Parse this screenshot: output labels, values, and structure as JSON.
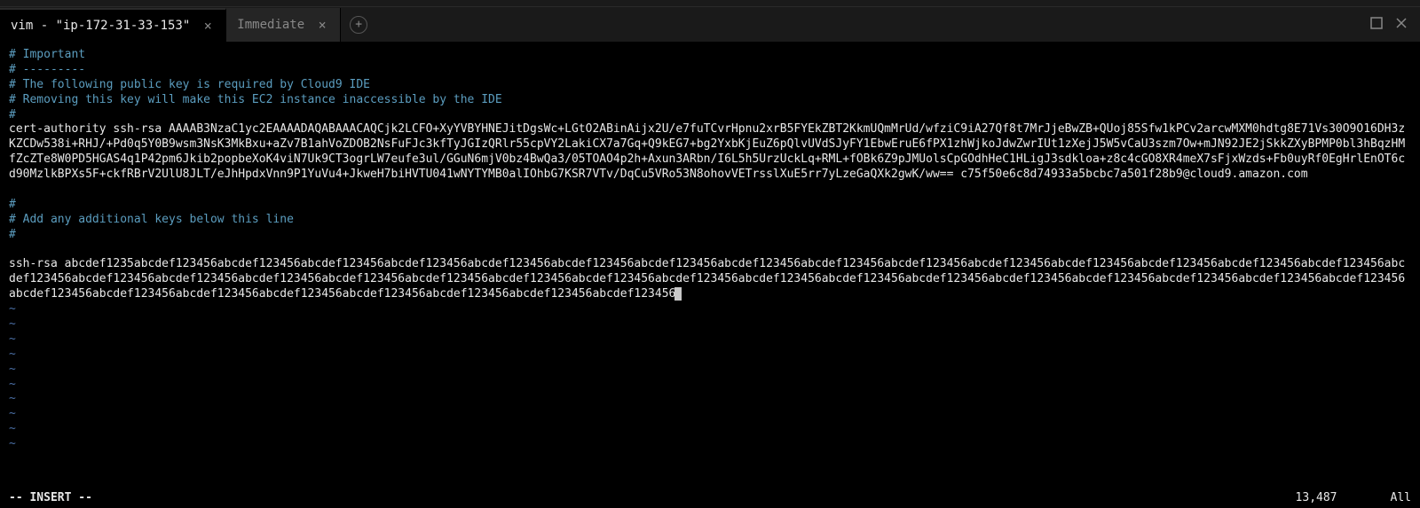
{
  "tabs": {
    "items": [
      {
        "label": "vim - \"ip-172-31-33-153\"",
        "active": true
      },
      {
        "label": "Immediate",
        "active": false
      }
    ]
  },
  "editor": {
    "comments1": [
      "# Important",
      "# ---------",
      "# The following public key is required by Cloud9 IDE",
      "# Removing this key will make this EC2 instance inaccessible by the IDE",
      "#"
    ],
    "cert_line": "cert-authority ssh-rsa AAAAB3NzaC1yc2EAAAADAQABAAACAQCjk2LCFO+XyYVBYHNEJitDgsWc+LGtO2ABinAijx2U/e7fuTCvrHpnu2xrB5FYEkZBT2KkmUQmMrUd/wfziC9iA27Qf8t7MrJjeBwZB+QUoj85Sfw1kPCv2arcwMXM0hdtg8E71Vs30O9O16DH3zKZCDw538i+RHJ/+Pd0q5Y0B9wsm3NsK3MkBxu+aZv7B1ahVoZDOB2NsFuFJc3kfTyJGIzQRlr55cpVY2LakiCX7a7Gq+Q9kEG7+bg2YxbKjEuZ6pQlvUVdSJyFY1EbwEruE6fPX1zhWjkoJdwZwrIUt1zXejJ5W5vCaU3szm7Ow+mJN92JE2jSkkZXyBPMP0bl3hBqzHMfZcZTe8W0PD5HGAS4q1P42pm6Jkib2popbeXoK4viN7Uk9CT3ogrLW7eufe3ul/GGuN6mjV0bz4BwQa3/05TOAO4p2h+Axun3ARbn/I6L5h5UrzUckLq+RML+fOBk6Z9pJMUolsCpGOdhHeC1HLigJ3sdkloa+z8c4cGO8XR4meX7sFjxWzds+Fb0uyRf0EgHrlEnOT6cd90MzlkBPXs5F+ckfRBrV2UlU8JLT/eJhHpdxVnn9P1YuVu4+JkweH7biHVTU041wNYTYMB0alIOhbG7KSR7VTv/DqCu5VRo53N8ohovVETrsslXuE5rr7yLzeGaQXk2gwK/ww== c75f50e6c8d74933a5bcbc7a501f28b9@cloud9.amazon.com",
    "comments2": [
      "#",
      "# Add any additional keys below this line",
      "#"
    ],
    "ssh_line": "ssh-rsa abcdef1235abcdef123456abcdef123456abcdef123456abcdef123456abcdef123456abcdef123456abcdef123456abcdef123456abcdef123456abcdef123456abcdef123456abcdef123456abcdef123456abcdef123456abcdef123456abcdef123456abcdef123456abcdef123456abcdef123456abcdef123456abcdef123456abcdef123456abcdef123456abcdef123456abcdef123456abcdef123456abcdef123456abcdef123456abcdef123456abcdef123456abcdef123456abcdef123456abcdef123456abcdef123456abcdef123456abcdef123456abcdef123456abcdef123456abcdef123456abcdef123456",
    "tilde": "~"
  },
  "status": {
    "mode": "-- INSERT --",
    "position": "13,487",
    "scroll": "All"
  }
}
